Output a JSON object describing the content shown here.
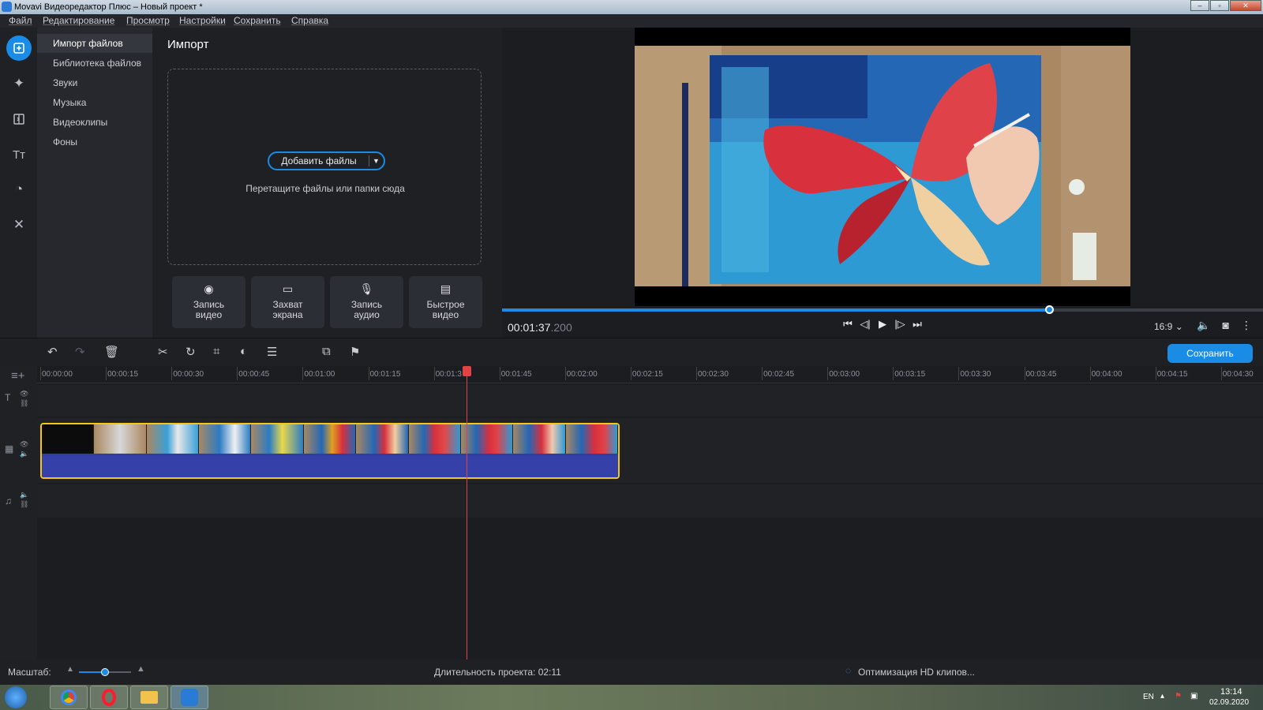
{
  "window": {
    "title": "Movavi Видеоредактор Плюс – Новый проект *"
  },
  "menu": [
    "Файл",
    "Редактирование",
    "Просмотр",
    "Настройки",
    "Сохранить",
    "Справка"
  ],
  "categories": {
    "items": [
      "Импорт файлов",
      "Библиотека файлов",
      "Звуки",
      "Музыка",
      "Видеоклипы",
      "Фоны"
    ],
    "active_index": 0
  },
  "import": {
    "title": "Импорт",
    "add_files_label": "Добавить файлы",
    "drop_hint": "Перетащите файлы или папки сюда",
    "tiles": [
      {
        "icon": "webcam-icon",
        "line1": "Запись",
        "line2": "видео"
      },
      {
        "icon": "monitor-icon",
        "line1": "Захват",
        "line2": "экрана"
      },
      {
        "icon": "microphone-icon",
        "line1": "Запись",
        "line2": "аудио"
      },
      {
        "icon": "quick-video-icon",
        "line1": "Быстрое",
        "line2": "видео"
      }
    ]
  },
  "player": {
    "timecode_main": "00:01:37",
    "timecode_ms": ".200",
    "aspect_ratio": "16:9",
    "progress": 0.65
  },
  "toolbar": {
    "save_label": "Сохранить"
  },
  "timeline": {
    "ruler": [
      "00:00:00",
      "00:00:15",
      "00:00:30",
      "00:00:45",
      "00:01:00",
      "00:01:15",
      "00:01:3",
      "00:01:45",
      "00:02:00",
      "00:02:15",
      "00:02:30",
      "00:02:45",
      "00:03:00",
      "00:03:15",
      "00:03:30",
      "00:03:45",
      "00:04:00",
      "00:04:15",
      "00:04:30"
    ]
  },
  "status": {
    "scale_label": "Масштаб:",
    "duration_label": "Длительность проекта: 02:11",
    "optimization_label": "Оптимизация HD клипов..."
  },
  "tray": {
    "lang": "EN",
    "time": "13:14",
    "date": "02.09.2020"
  },
  "colors": {
    "accent": "#1a8ce5",
    "clip_border": "#f5c518",
    "playhead": "#e04343",
    "audio": "#3540a8"
  }
}
